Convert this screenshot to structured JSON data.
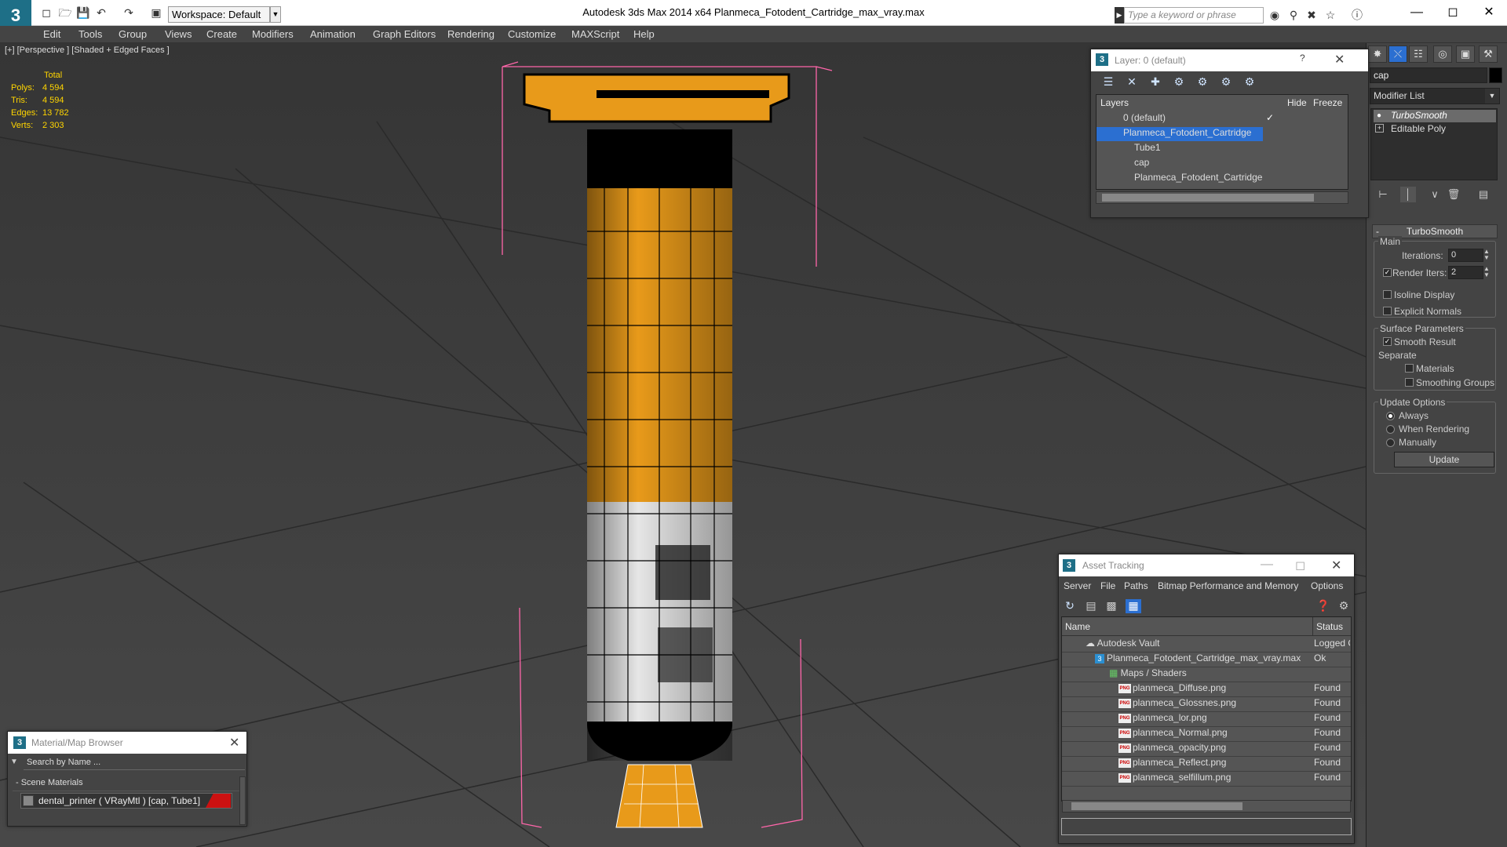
{
  "app": {
    "logo": "3",
    "title": "Autodesk 3ds Max  2014 x64     Planmeca_Fotodent_Cartridge_max_vray.max",
    "workspace": "Workspace: Default",
    "search_placeholder": "Type a keyword or phrase"
  },
  "menu": [
    "Edit",
    "Tools",
    "Group",
    "Views",
    "Create",
    "Modifiers",
    "Animation",
    "Graph Editors",
    "Rendering",
    "Customize",
    "MAXScript",
    "Help"
  ],
  "viewport": {
    "label": "[+] [Perspective ] [Shaded + Edged Faces ]",
    "stats_header": "Total",
    "stats": [
      {
        "k": "Polys:",
        "v": "4 594"
      },
      {
        "k": "Tris:",
        "v": "4 594"
      },
      {
        "k": "Edges:",
        "v": "13 782"
      },
      {
        "k": "Verts:",
        "v": "2 303"
      }
    ]
  },
  "command_panel": {
    "object_name": "cap",
    "modifier_list": "Modifier List",
    "stack": [
      "TurboSmooth",
      "Editable Poly"
    ],
    "rollout_title": "TurboSmooth",
    "main_label": "Main",
    "iterations_label": "Iterations:",
    "iterations": "0",
    "render_iters_label": "Render Iters:",
    "render_iters": "2",
    "isoline": "Isoline Display",
    "explicit_normals": "Explicit Normals",
    "surface_params": "Surface Parameters",
    "smooth_result": "Smooth Result",
    "separate": "Separate",
    "materials": "Materials",
    "smoothing_groups": "Smoothing Groups",
    "update_options": "Update Options",
    "always": "Always",
    "when_rendering": "When Rendering",
    "manually": "Manually",
    "update": "Update"
  },
  "layer_dialog": {
    "title": "Layer: 0 (default)",
    "help": "?",
    "col_layers": "Layers",
    "col_hide": "Hide",
    "col_freeze": "Freeze",
    "rows": [
      "0 (default)",
      "Planmeca_Fotodent_Cartridge",
      "Tube1",
      "cap",
      "Planmeca_Fotodent_Cartridge"
    ]
  },
  "asset_tracking": {
    "title": "Asset Tracking",
    "menu": [
      "Server",
      "File",
      "Paths",
      "Bitmap Performance and Memory",
      "Options"
    ],
    "col_name": "Name",
    "col_status": "Status",
    "rows": [
      {
        "name": "Autodesk Vault",
        "status": "Logged O"
      },
      {
        "name": "Planmeca_Fotodent_Cartridge_max_vray.max",
        "status": "Ok"
      },
      {
        "name": "Maps / Shaders",
        "status": ""
      },
      {
        "name": "planmeca_Diffuse.png",
        "status": "Found"
      },
      {
        "name": "planmeca_Glossnes.png",
        "status": "Found"
      },
      {
        "name": "planmeca_lor.png",
        "status": "Found"
      },
      {
        "name": "planmeca_Normal.png",
        "status": "Found"
      },
      {
        "name": "planmeca_opacity.png",
        "status": "Found"
      },
      {
        "name": "planmeca_Reflect.png",
        "status": "Found"
      },
      {
        "name": "planmeca_selfillum.png",
        "status": "Found"
      }
    ]
  },
  "material_browser": {
    "title": "Material/Map Browser",
    "search": "Search by Name ...",
    "group": "- Scene Materials",
    "item": "dental_printer  ( VRayMtl )  [cap, Tube1]"
  },
  "colors": {
    "accent": "#2b6fd1",
    "model_orange": "#e89a1a",
    "selection_wire": "#ff66aa",
    "stats": "#ffd500"
  }
}
